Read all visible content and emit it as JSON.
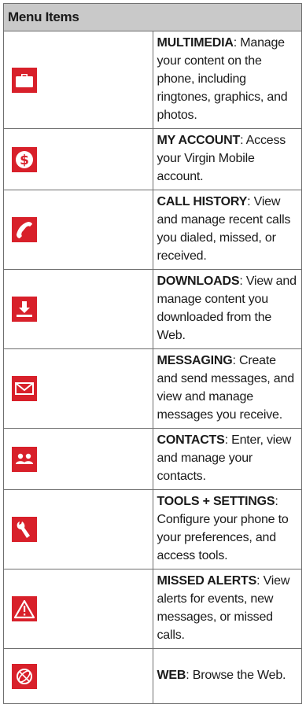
{
  "table": {
    "header": "Menu Items",
    "rows": [
      {
        "icon": "briefcase-icon",
        "name": "MULTIMEDIA",
        "desc": ": Manage your content on the phone, including ringtones, graphics, and photos."
      },
      {
        "icon": "dollar-coin-icon",
        "name": "MY ACCOUNT",
        "desc": ": Access your Virgin Mobile account."
      },
      {
        "icon": "phone-handset-icon",
        "name": "CALL HISTORY",
        "desc": ": View and manage recent calls you dialed, missed, or received."
      },
      {
        "icon": "download-tray-icon",
        "name": "DOWNLOADS",
        "desc": ": View and manage content you downloaded from the Web."
      },
      {
        "icon": "envelope-icon",
        "name": "MESSAGING",
        "desc": ": Create and send messages, and view and manage messages you receive."
      },
      {
        "icon": "people-icon",
        "name": "CONTACTS",
        "desc": ": Enter, view and manage your contacts."
      },
      {
        "icon": "wrench-icon",
        "name": "TOOLS + SETTINGS",
        "desc": ": Configure your phone to your preferences, and access tools."
      },
      {
        "icon": "warning-triangle-icon",
        "name": "MISSED ALERTS",
        "desc": ": View alerts for events, new messages, or missed calls."
      },
      {
        "icon": "web-globe-icon",
        "name": "WEB",
        "desc": ": Browse the Web."
      }
    ]
  },
  "colors": {
    "icon_red": "#d8202a",
    "header_bg": "#c9c9c9",
    "border": "#6f6f6f"
  }
}
